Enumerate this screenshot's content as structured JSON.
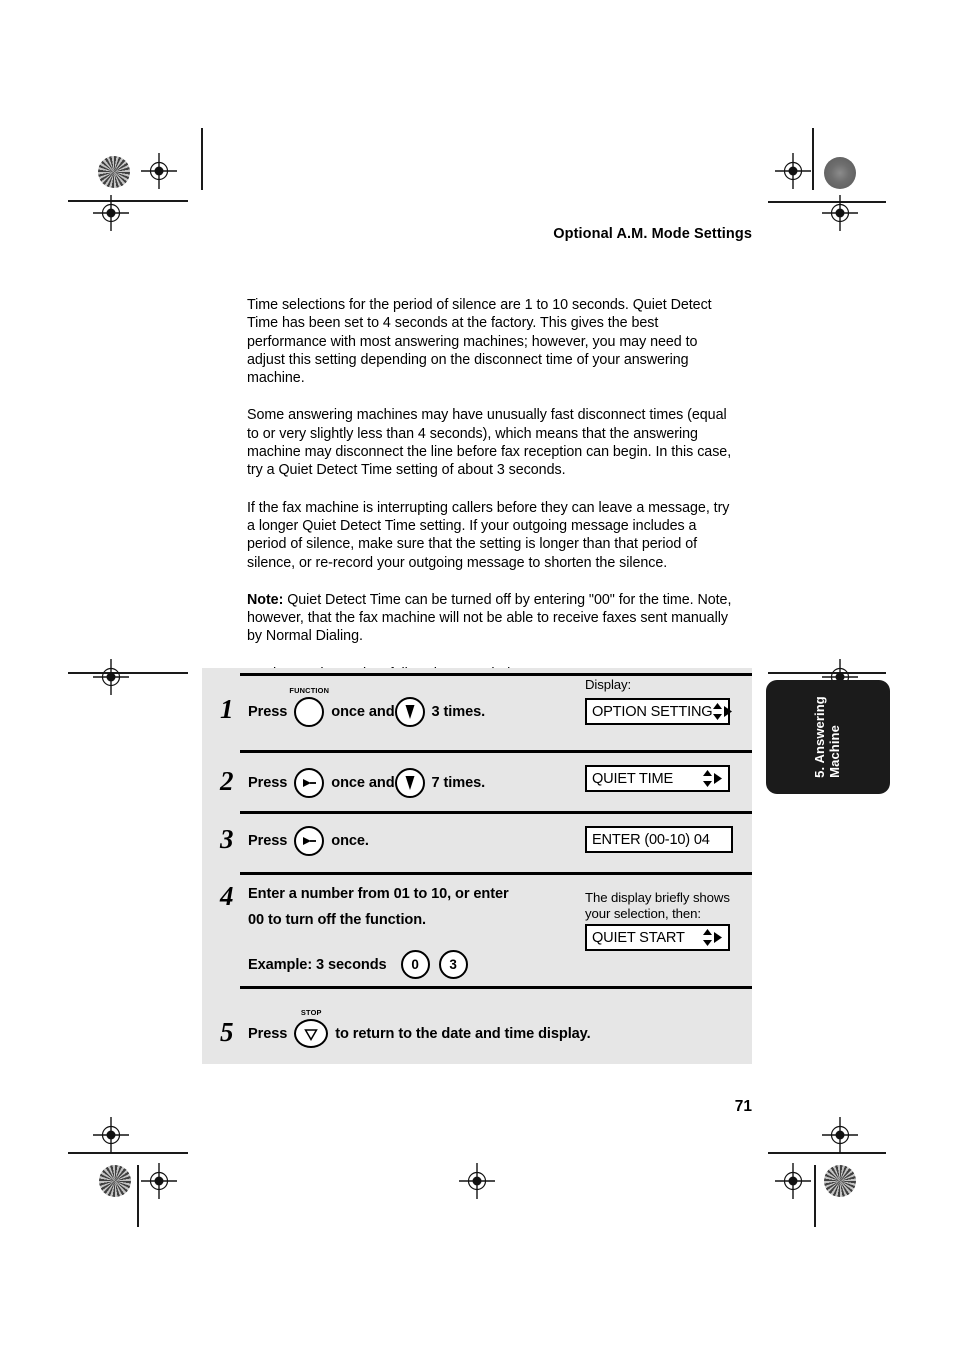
{
  "document": {
    "running_head": "Optional A.M. Mode Settings",
    "page_number": "71",
    "side_tab": "5. Answering\nMachine"
  },
  "body": {
    "paragraphs": [
      "Time selections for the period of silence are 1 to 10 seconds. Quiet Detect Time has been set to 4 seconds at the factory. This gives the best performance with most answering machines; however, you may need to adjust this setting depending on the disconnect time of your answering machine.",
      "Some answering machines may have unusually fast disconnect times (equal to or very slightly less than 4 seconds), which means that the answering machine may disconnect the line before fax reception can begin. In this case, try a Quiet Detect Time setting of about 3 seconds.",
      "If the fax machine is interrupting callers before they can leave a message, try a longer Quiet Detect Time setting. If your outgoing message includes a period of silence, make sure that the setting is longer than that period of silence, or re-record your outgoing message to shorten the silence."
    ],
    "note_label": "Note:",
    "note_text": " Quiet Detect Time can be turned off by entering \"00\" for the time. Note, however, that the fax machine will not be able to receive faxes sent manually by Normal Dialing.",
    "closing": "To change the setting, follow the steps below."
  },
  "steps": {
    "display_heading": "Display:",
    "step1": {
      "number": "1",
      "press_word": "Press",
      "key1_label": "FUNCTION",
      "mid_word": "once and",
      "end_word": "3 times.",
      "display_text": "OPTION SETTING"
    },
    "step2": {
      "number": "2",
      "press_word": "Press",
      "mid_word": "once and",
      "end_word": "7 times.",
      "display_text": "QUIET TIME"
    },
    "step3": {
      "number": "3",
      "press_word": "Press",
      "end_word": "once.",
      "display_text": "ENTER (00-10) 04"
    },
    "step4": {
      "number": "4",
      "line1": "Enter a number from 01 to 10, or enter",
      "line2": "00 to turn off the function.",
      "example_label": "Example: 3 seconds",
      "key_digit_1": "0",
      "key_digit_2": "3",
      "display_caption": "The display briefly shows\nyour selection, then:",
      "display_text": "QUIET START"
    },
    "step5": {
      "number": "5",
      "press_word": "Press",
      "key_label": "STOP",
      "end_word": "to return to the date and time display."
    }
  },
  "icons": {
    "function_key": "blank-round-key-icon",
    "down_arrow_key": "down-arrow-key-icon",
    "right_arrow_key": "right-arrow-key-icon",
    "stop_key": "stop-key-icon",
    "display_updown_arrows": "up-down-arrow-icon",
    "display_right_arrow": "right-arrow-icon"
  },
  "colors": {
    "panel_gray": "#e6e6e6",
    "tab_black": "#1b1b1b",
    "ink": "#000000"
  }
}
